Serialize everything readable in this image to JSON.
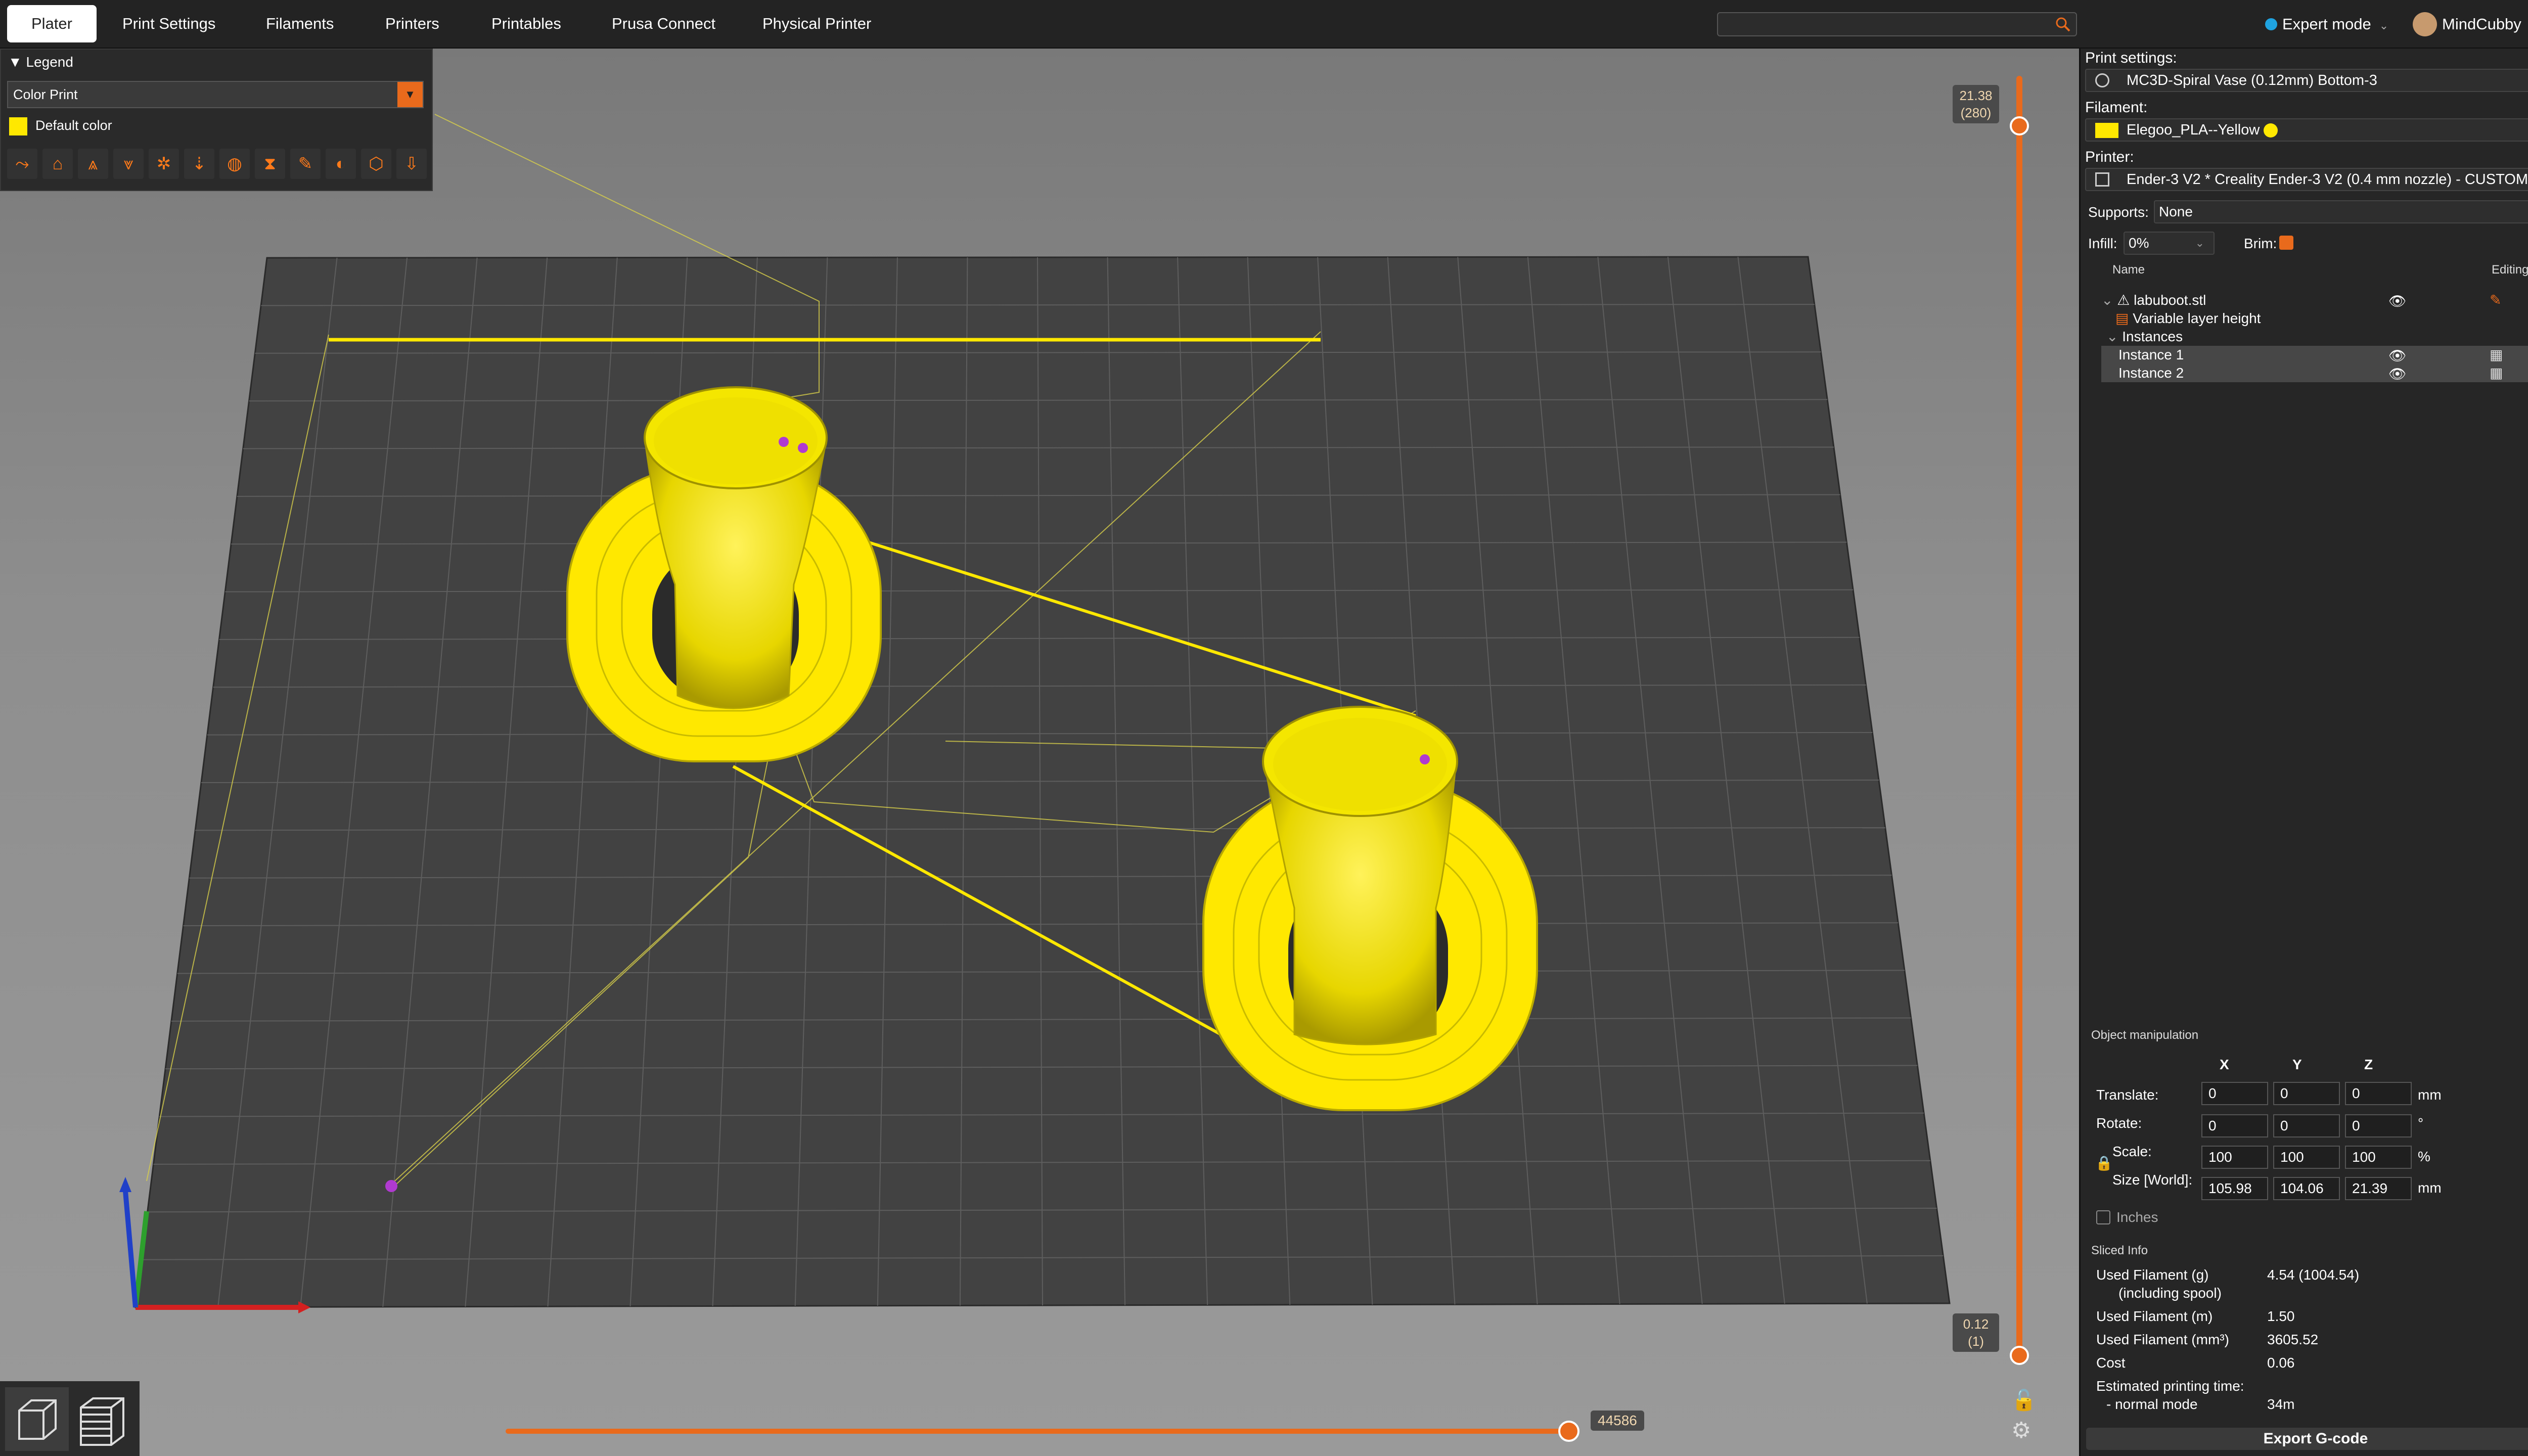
{
  "topbar": {
    "tabs": [
      "Plater",
      "Print Settings",
      "Filaments",
      "Printers",
      "Printables",
      "Prusa Connect",
      "Physical Printer"
    ],
    "active_tab": "Plater",
    "mode": "Expert mode",
    "user": "MindCubby"
  },
  "legend": {
    "title": "Legend",
    "view_type": "Color Print",
    "item": "Default color",
    "item_color": "#ffe800"
  },
  "vslider": {
    "top_value": "21.38",
    "top_layer": "(280)",
    "bottom_value": "0.12",
    "bottom_layer": "(1)"
  },
  "hslider": {
    "value": "44586"
  },
  "panel": {
    "print_settings_label": "Print settings:",
    "print_settings_value": "MC3D-Spiral Vase (0.12mm) Bottom-3",
    "filament_label": "Filament:",
    "filament_value": "Elegoo_PLA--Yellow",
    "filament_color": "#ffe800",
    "printer_label": "Printer:",
    "printer_value": "Ender-3 V2 * Creality Ender-3 V2 (0.4 mm nozzle) - CUSTOM",
    "supports_label": "Supports:",
    "supports_value": "None",
    "infill_label": "Infill:",
    "infill_value": "0%",
    "brim_label": "Brim:",
    "brim_checked": true
  },
  "objects": {
    "col_name": "Name",
    "col_editing": "Editing",
    "rows": [
      {
        "label": "labuboot.stl"
      },
      {
        "label": "Variable layer height"
      },
      {
        "label": "Instances"
      },
      {
        "label": "Instance 1"
      },
      {
        "label": "Instance 2"
      }
    ]
  },
  "manip": {
    "title": "Object manipulation",
    "axes": [
      "X",
      "Y",
      "Z"
    ],
    "translate_label": "Translate:",
    "translate": [
      "0",
      "0",
      "0"
    ],
    "translate_unit": "mm",
    "rotate_label": "Rotate:",
    "rotate": [
      "0",
      "0",
      "0"
    ],
    "rotate_unit": "°",
    "scale_label": "Scale:",
    "scale": [
      "100",
      "100",
      "100"
    ],
    "scale_unit": "%",
    "size_label": "Size [World]:",
    "size": [
      "105.98",
      "104.06",
      "21.39"
    ],
    "size_unit": "mm",
    "inches_label": "Inches"
  },
  "sliced": {
    "title": "Sliced Info",
    "rows": [
      {
        "label": "Used Filament (g)",
        "value": "4.54 (1004.54)"
      },
      {
        "label": "(including spool)",
        "value": ""
      },
      {
        "label": "Used Filament (m)",
        "value": "1.50"
      },
      {
        "label": "Used Filament (mm³)",
        "value": "3605.52"
      },
      {
        "label": "Cost",
        "value": "0.06"
      },
      {
        "label": "Estimated printing time:",
        "value": ""
      },
      {
        "label": "- normal mode",
        "value": "34m"
      }
    ],
    "export_label": "Export G-code",
    "export_short": "G"
  },
  "colors": {
    "accent": "#e96a1c",
    "model": "#ffe800"
  }
}
